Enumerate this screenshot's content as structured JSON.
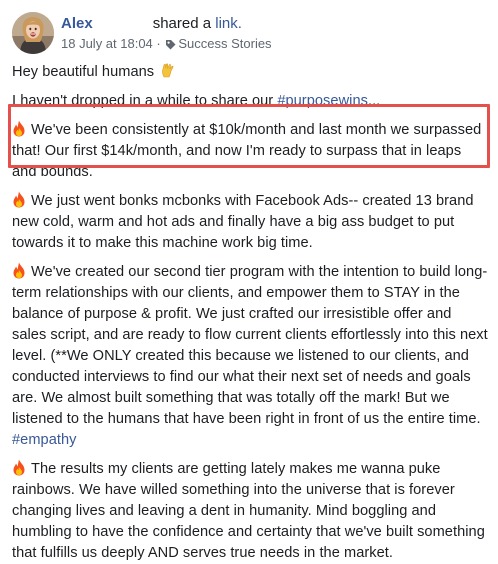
{
  "post": {
    "author": "Alex",
    "shared_text": "shared a",
    "shared_link": "link.",
    "date": "18 July at 18:04",
    "separator": " · ",
    "group": "Success Stories",
    "greeting": "Hey beautiful humans",
    "greeting_emoji": "vulcan-salute-icon",
    "intro_text": "I haven't dropped in a while to share our ",
    "intro_hashtag": "#purposewins",
    "intro_ellipsis": "...",
    "highlight_color": "#e4504b",
    "link_color": "#385898",
    "paragraphs": [
      {
        "emoji": "fire-icon",
        "text": "We've been consistently at $10k/month and last month we surpassed that! Our first $14k/month, and now I'm ready to surpass that in leaps and bounds."
      },
      {
        "emoji": "fire-icon",
        "text": "We just went bonks mcbonks with Facebook Ads-- created 13 brand new cold, warm and hot ads and finally have a big ass budget to put towards it to make this machine work big time."
      },
      {
        "emoji": "fire-icon",
        "text": "We've created our second tier program with the intention to build long-term relationships with our clients, and empower them to STAY in the balance of purpose & profit. We just crafted our irresistible offer and sales script, and are ready to flow current clients effortlessly into this next level. (**We ONLY created this because we listened to our clients, and conducted interviews to find our what their next set of needs and goals are. We almost built something that was totally off the mark! But we listened to the humans that have been right in front of us the entire time.",
        "hashtag": "#empathy"
      },
      {
        "emoji": "fire-icon",
        "text": "The results my clients are getting lately makes me wanna puke rainbows. We have willed something into the universe that is forever changing lives and leaving a dent in humanity. Mind boggling and humbling to have the confidence and certainty that we've built something that fulfills us deeply AND serves true needs in the market."
      }
    ]
  }
}
